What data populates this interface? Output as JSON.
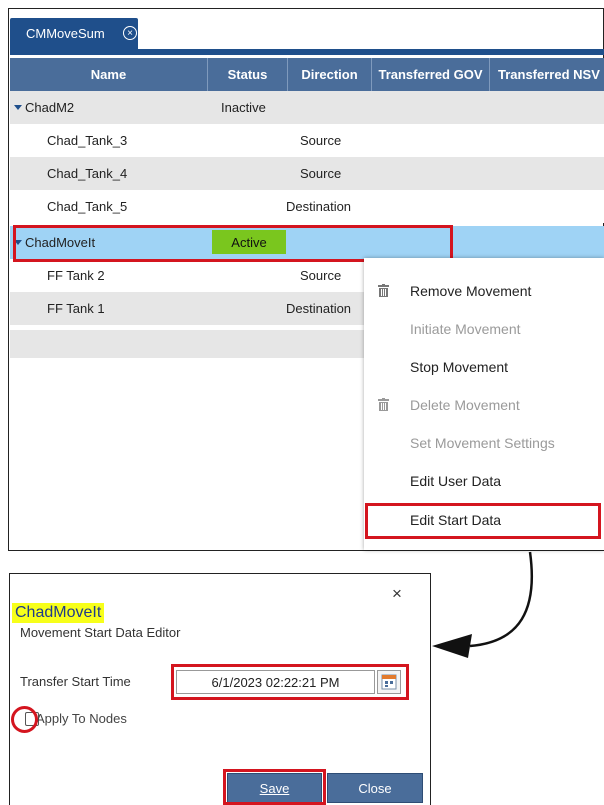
{
  "tab": {
    "label": "CMMoveSum",
    "close_glyph": "×"
  },
  "grid": {
    "columns": [
      "Name",
      "Status",
      "Direction",
      "Transferred GOV",
      "Transferred NSV"
    ],
    "rows": [
      {
        "name": "ChadM2",
        "status": "Inactive",
        "direction": "",
        "group": true
      },
      {
        "name": "Chad_Tank_3",
        "status": "",
        "direction": "Source",
        "group": false
      },
      {
        "name": "Chad_Tank_4",
        "status": "",
        "direction": "Source",
        "group": false
      },
      {
        "name": "Chad_Tank_5",
        "status": "",
        "direction": "Destination",
        "group": false
      },
      {
        "name": "ChadMoveIt",
        "status": "Active",
        "direction": "",
        "group": true,
        "selected": true
      },
      {
        "name": "FF Tank 2",
        "status": "",
        "direction": "Source",
        "group": false
      },
      {
        "name": "FF Tank 1",
        "status": "",
        "direction": "Destination",
        "group": false
      }
    ]
  },
  "context_menu": {
    "items": [
      {
        "label": "Remove Movement",
        "icon": "trash-icon",
        "enabled": true
      },
      {
        "label": "Initiate Movement",
        "icon": "",
        "enabled": false
      },
      {
        "label": "Stop Movement",
        "icon": "",
        "enabled": true
      },
      {
        "label": "Delete Movement",
        "icon": "trash-icon",
        "enabled": false
      },
      {
        "label": "Set Movement Settings",
        "icon": "",
        "enabled": false
      },
      {
        "label": "Edit User Data",
        "icon": "",
        "enabled": true
      },
      {
        "label": "Edit Start Data",
        "icon": "",
        "enabled": true,
        "highlighted": true
      }
    ]
  },
  "dialog": {
    "title": "ChadMoveIt",
    "subtitle": "Movement Start Data Editor",
    "close_glyph": "×",
    "transfer_label": "Transfer Start Time",
    "transfer_value": "6/1/2023 02:22:21 PM",
    "apply_label": "Apply To Nodes",
    "apply_checked": false,
    "save_label": "Save",
    "close_label": "Close"
  },
  "colors": {
    "header_blue": "#4a6d9a",
    "tab_blue": "#1f4f8b",
    "selected_row": "#9fd3f5",
    "active_badge": "#7ac61e",
    "annotation_red": "#d4151f",
    "title_highlight": "#f7ff1a"
  }
}
